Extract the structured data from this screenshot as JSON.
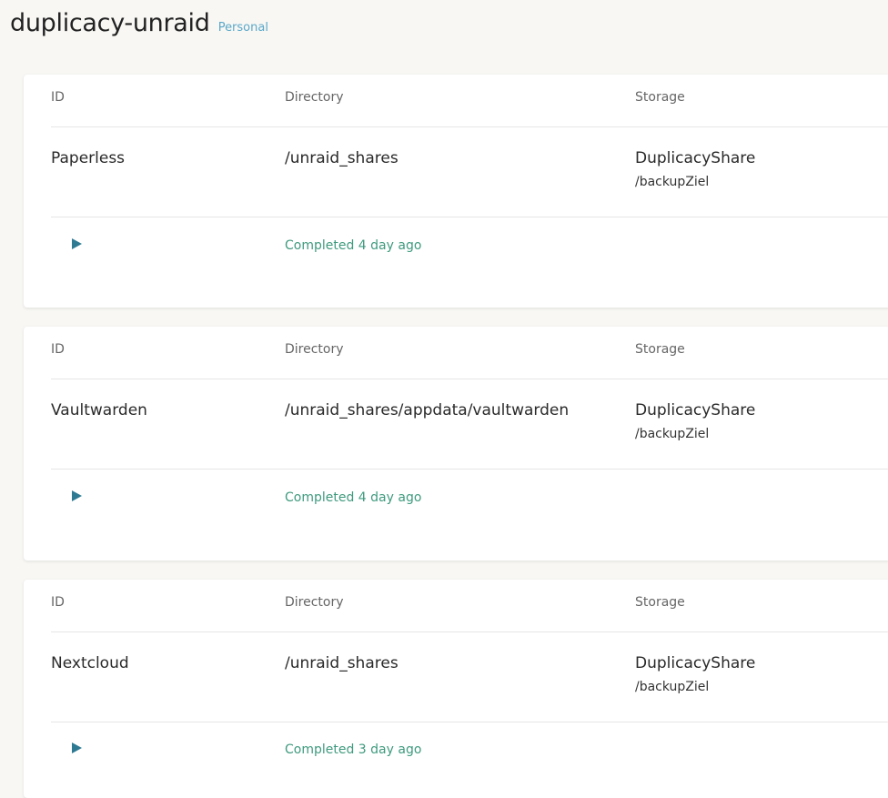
{
  "page": {
    "title": "duplicacy-unraid",
    "badge": "Personal"
  },
  "table_headers": {
    "id": "ID",
    "directory": "Directory",
    "storage": "Storage"
  },
  "backups": [
    {
      "id": "Paperless",
      "directory": "/unraid_shares",
      "storage_name": "DuplicacyShare",
      "storage_path": "/backupZiel",
      "status": "Completed 4 day ago"
    },
    {
      "id": "Vaultwarden",
      "directory": "/unraid_shares/appdata/vaultwarden",
      "storage_name": "DuplicacyShare",
      "storage_path": "/backupZiel",
      "status": "Completed 4 day ago"
    },
    {
      "id": "Nextcloud",
      "directory": "/unraid_shares",
      "storage_name": "DuplicacyShare",
      "storage_path": "/backupZiel",
      "status": "Completed 3 day ago"
    }
  ],
  "icons": {
    "run": "play-icon"
  },
  "colors": {
    "background": "#f8f7f4",
    "badge": "#5ba8c8",
    "status": "#3f9a7e",
    "play_icon": "#2e7a93"
  }
}
